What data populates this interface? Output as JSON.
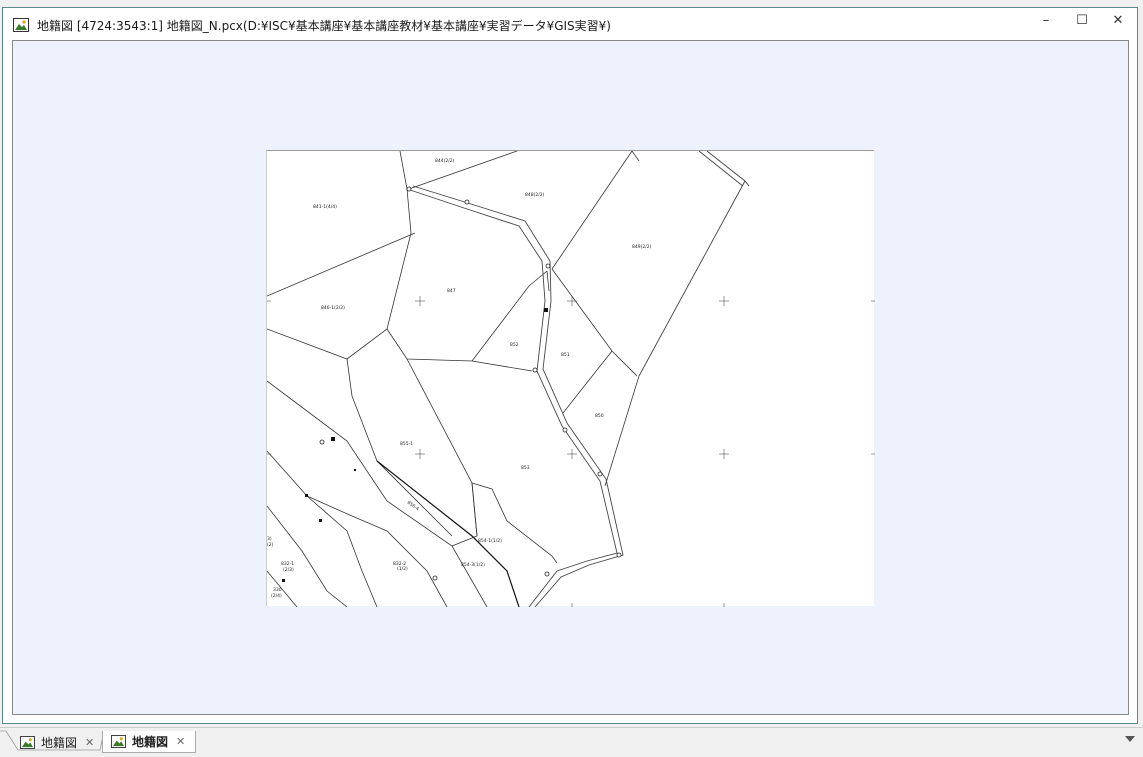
{
  "window": {
    "title": "地籍図 [4724:3543:1] 地籍図_N.pcx(D:¥ISC¥基本講座¥基本講座教材¥基本講座¥実習データ¥GIS実習¥)",
    "minimize_glyph": "–",
    "maximize_glyph": "☐",
    "close_glyph": "✕"
  },
  "map": {
    "parcel_labels": {
      "p844": "844(2/2)",
      "p848": "848(2/2)",
      "p849": "849(2/2)",
      "p841": "841-1(4/4)",
      "p847": "847",
      "p846": "846-1(2/2)",
      "p852": "852",
      "p851": "851",
      "p850": "850",
      "p855": "855-1",
      "p853": "853",
      "p856": "856-4",
      "p8541": "854-1(1/2)",
      "p8543": "854-3(1/2)",
      "p832": "832-1",
      "p832b": "(2/3)",
      "p8322": "832-2",
      "p8322b": "(1/2)",
      "p330": "330",
      "p330b": "(2/4)",
      "edge1": "3)",
      "edge2": "(2)"
    }
  },
  "tabs": [
    {
      "label": "地籍図",
      "close": "✕"
    },
    {
      "label": "地籍図",
      "close": "✕"
    }
  ]
}
